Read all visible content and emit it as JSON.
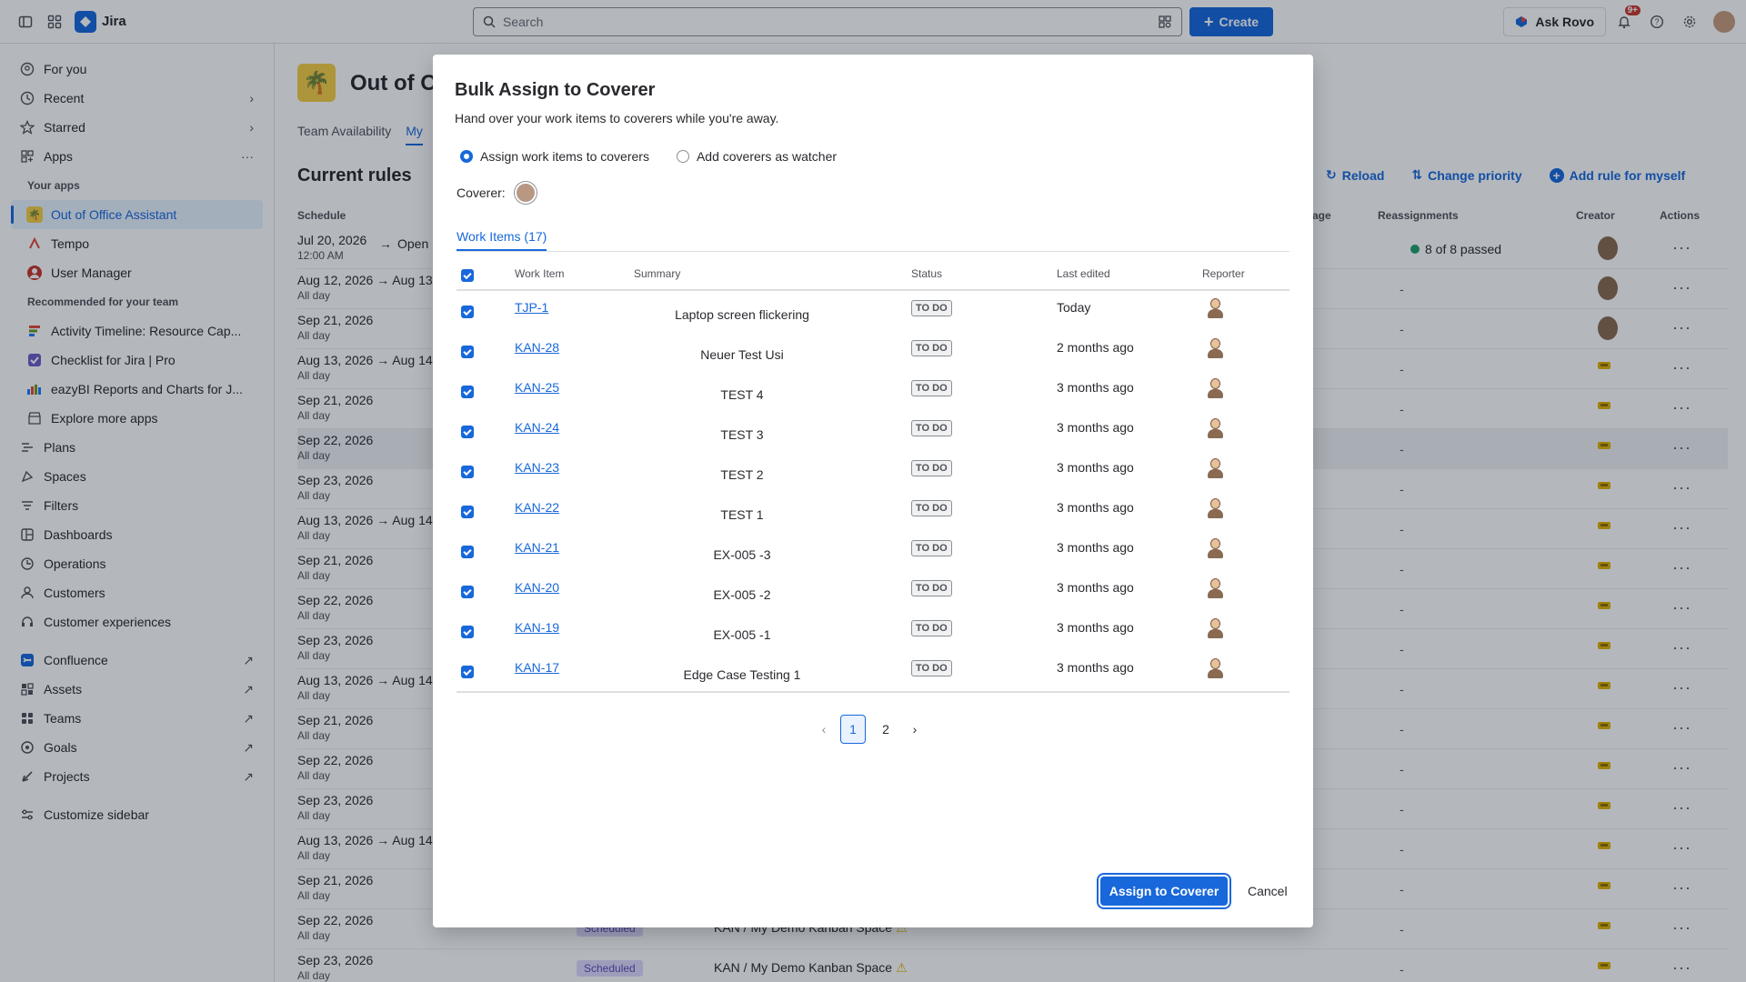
{
  "topbar": {
    "brand": "Jira",
    "search_placeholder": "Search",
    "create_label": "Create",
    "ask_rovo": "Ask Rovo",
    "notif_count": "9+"
  },
  "sidebar": {
    "items_top": [
      {
        "label": "For you",
        "icon": "person-circle-icon"
      },
      {
        "label": "Recent",
        "icon": "clock-icon"
      },
      {
        "label": "Starred",
        "icon": "star-icon"
      },
      {
        "label": "Apps",
        "icon": "apps-icon"
      }
    ],
    "your_apps_heading": "Your apps",
    "your_apps": [
      {
        "label": "Out of Office Assistant",
        "color": "#f5cd47"
      },
      {
        "label": "Tempo",
        "color": "#e2483d"
      },
      {
        "label": "User Manager",
        "color": "#c9372c"
      }
    ],
    "recommended_heading": "Recommended for your team",
    "recommended": [
      {
        "label": "Activity Timeline: Resource Cap...",
        "color": "#6a9a23"
      },
      {
        "label": "Checklist for Jira | Pro",
        "color": "#6e5dc6"
      },
      {
        "label": "eazyBI Reports and Charts for J...",
        "color": "#1d7afc"
      },
      {
        "label": "Explore more apps",
        "color": "#505258"
      }
    ],
    "items_main": [
      {
        "label": "Plans",
        "icon": "plans-icon"
      },
      {
        "label": "Spaces",
        "icon": "spaces-icon"
      },
      {
        "label": "Filters",
        "icon": "filter-icon"
      },
      {
        "label": "Dashboards",
        "icon": "dashboard-icon"
      },
      {
        "label": "Operations",
        "icon": "operations-icon"
      },
      {
        "label": "Customers",
        "icon": "customers-icon"
      },
      {
        "label": "Customer experiences",
        "icon": "headset-icon"
      }
    ],
    "items_external": [
      {
        "label": "Confluence",
        "icon": "confluence-icon"
      },
      {
        "label": "Assets",
        "icon": "assets-icon"
      },
      {
        "label": "Teams",
        "icon": "teams-icon"
      },
      {
        "label": "Goals",
        "icon": "goals-icon"
      },
      {
        "label": "Projects",
        "icon": "projects-icon"
      }
    ],
    "customize": "Customize sidebar"
  },
  "page": {
    "title": "Out of O",
    "tabs": [
      "Team Availability",
      "My"
    ],
    "section_title": "Current rules",
    "actions": [
      "Reload",
      "Change priority",
      "Add rule for myself"
    ],
    "columns": {
      "schedule": "Schedule",
      "stage": "age",
      "reassignments": "Reassignments",
      "creator": "Creator",
      "actions": "Actions"
    },
    "first_row_extra": "Open",
    "passed_text": "8 of 8 passed",
    "dash": "-",
    "scheduled_label": "Scheduled",
    "project_label": "KAN / My Demo Kanban Space",
    "rows": [
      {
        "date": "Jul 20, 2026",
        "sub": "12:00 AM"
      },
      {
        "date": "Aug 12, 2026 → Aug 13",
        "sub": "All day"
      },
      {
        "date": "Sep 21, 2026",
        "sub": "All day"
      },
      {
        "date": "Aug 13, 2026 → Aug 14",
        "sub": "All day"
      },
      {
        "date": "Sep 21, 2026",
        "sub": "All day"
      },
      {
        "date": "Sep 22, 2026",
        "sub": "All day"
      },
      {
        "date": "Sep 23, 2026",
        "sub": "All day"
      },
      {
        "date": "Aug 13, 2026 → Aug 14",
        "sub": "All day"
      },
      {
        "date": "Sep 21, 2026",
        "sub": "All day"
      },
      {
        "date": "Sep 22, 2026",
        "sub": "All day"
      },
      {
        "date": "Sep 23, 2026",
        "sub": "All day"
      },
      {
        "date": "Aug 13, 2026 → Aug 14",
        "sub": "All day"
      },
      {
        "date": "Sep 21, 2026",
        "sub": "All day"
      },
      {
        "date": "Sep 22, 2026",
        "sub": "All day"
      },
      {
        "date": "Sep 23, 2026",
        "sub": "All day"
      },
      {
        "date": "Aug 13, 2026 → Aug 14",
        "sub": "All day"
      },
      {
        "date": "Sep 21, 2026",
        "sub": "All day"
      },
      {
        "date": "Sep 22, 2026",
        "sub": "All day"
      },
      {
        "date": "Sep 23, 2026",
        "sub": "All day"
      }
    ]
  },
  "modal": {
    "title": "Bulk Assign to Coverer",
    "subtitle": "Hand over your work items to coverers while you're away.",
    "radio_assign": "Assign work items to coverers",
    "radio_watcher": "Add coverers as watcher",
    "coverer_label": "Coverer:",
    "tab_label": "Work Items (17)",
    "headers": {
      "work_item": "Work Item",
      "summary": "Summary",
      "status": "Status",
      "last_edited": "Last edited",
      "reporter": "Reporter"
    },
    "items": [
      {
        "key": "TJP-1",
        "summary": "Laptop screen flickering",
        "status": "TO DO",
        "edited": "Today"
      },
      {
        "key": "KAN-28",
        "summary": "Neuer Test Usi",
        "status": "TO DO",
        "edited": "2 months ago"
      },
      {
        "key": "KAN-25",
        "summary": "TEST 4",
        "status": "TO DO",
        "edited": "3 months ago"
      },
      {
        "key": "KAN-24",
        "summary": "TEST 3",
        "status": "TO DO",
        "edited": "3 months ago"
      },
      {
        "key": "KAN-23",
        "summary": "TEST 2",
        "status": "TO DO",
        "edited": "3 months ago"
      },
      {
        "key": "KAN-22",
        "summary": "TEST 1",
        "status": "TO DO",
        "edited": "3 months ago"
      },
      {
        "key": "KAN-21",
        "summary": "EX-005 -3",
        "status": "TO DO",
        "edited": "3 months ago"
      },
      {
        "key": "KAN-20",
        "summary": "EX-005 -2",
        "status": "TO DO",
        "edited": "3 months ago"
      },
      {
        "key": "KAN-19",
        "summary": "EX-005 -1",
        "status": "TO DO",
        "edited": "3 months ago"
      },
      {
        "key": "KAN-17",
        "summary": "Edge Case Testing 1",
        "status": "TO DO",
        "edited": "3 months ago"
      }
    ],
    "pages": [
      "1",
      "2"
    ],
    "current_page": "1",
    "primary_button": "Assign to Coverer",
    "cancel_button": "Cancel"
  }
}
